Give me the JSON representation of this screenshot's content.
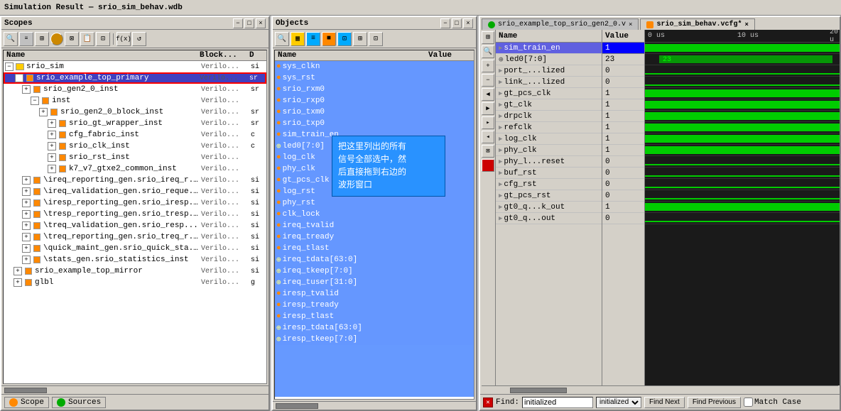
{
  "app": {
    "title": "Simulation Result — srio_sim_behav.wdb"
  },
  "scopes_panel": {
    "title": "Scopes",
    "columns": [
      "Name",
      "Block...",
      "D"
    ],
    "tree_items": [
      {
        "id": 1,
        "indent": 0,
        "expanded": true,
        "text": "srio_sim",
        "block": "Verilo...",
        "d": "si",
        "type": "module",
        "selected": false
      },
      {
        "id": 2,
        "indent": 1,
        "expanded": false,
        "text": "srio_example_top_primary",
        "block": "Verilo...",
        "d": "sr",
        "type": "inst",
        "selected": true,
        "red_border": true
      },
      {
        "id": 3,
        "indent": 2,
        "expanded": false,
        "text": "srio_gen2_0_inst",
        "block": "Verilo...",
        "d": "sr",
        "type": "inst",
        "selected": false
      },
      {
        "id": 4,
        "indent": 3,
        "expanded": true,
        "text": "inst",
        "block": "Verilo...",
        "d": "",
        "type": "inst",
        "selected": false
      },
      {
        "id": 5,
        "indent": 4,
        "expanded": false,
        "text": "srio_gen2_0_block_inst",
        "block": "Verilo...",
        "d": "sr",
        "type": "inst",
        "selected": false
      },
      {
        "id": 6,
        "indent": 5,
        "expanded": false,
        "text": "srio_gt_wrapper_inst",
        "block": "Verilo...",
        "d": "sr",
        "type": "inst",
        "selected": false
      },
      {
        "id": 7,
        "indent": 5,
        "expanded": false,
        "text": "cfg_fabric_inst",
        "block": "Verilo...",
        "d": "c",
        "type": "inst",
        "selected": false
      },
      {
        "id": 8,
        "indent": 5,
        "expanded": false,
        "text": "srio_clk_inst",
        "block": "Verilo...",
        "d": "c",
        "type": "inst",
        "selected": false
      },
      {
        "id": 9,
        "indent": 5,
        "expanded": false,
        "text": "srio_rst_inst",
        "block": "Verilo...",
        "d": "",
        "type": "inst",
        "selected": false
      },
      {
        "id": 10,
        "indent": 5,
        "expanded": false,
        "text": "k7_v7_gtxe2_common_inst",
        "block": "Verilo...",
        "d": "",
        "type": "inst",
        "selected": false
      },
      {
        "id": 11,
        "indent": 2,
        "expanded": false,
        "text": "\\ireq_reporting_gen.srio_ireq_r...",
        "block": "Verilo...",
        "d": "si",
        "type": "inst",
        "selected": false
      },
      {
        "id": 12,
        "indent": 2,
        "expanded": false,
        "text": "\\ireq_validation_gen.srio_reque...",
        "block": "Verilo...",
        "d": "si",
        "type": "inst",
        "selected": false
      },
      {
        "id": 13,
        "indent": 2,
        "expanded": false,
        "text": "\\iresp_reporting_gen.srio_iresp...",
        "block": "Verilo...",
        "d": "si",
        "type": "inst",
        "selected": false
      },
      {
        "id": 14,
        "indent": 2,
        "expanded": false,
        "text": "\\tresp_reporting_gen.srio_tresp...",
        "block": "Verilo...",
        "d": "si",
        "type": "inst",
        "selected": false
      },
      {
        "id": 15,
        "indent": 2,
        "expanded": false,
        "text": "\\treq_validation_gen.srio_resp...",
        "block": "Verilo...",
        "d": "si",
        "type": "inst",
        "selected": false
      },
      {
        "id": 16,
        "indent": 2,
        "expanded": false,
        "text": "\\treq_reporting_gen.srio_treq_r...",
        "block": "Verilo...",
        "d": "si",
        "type": "inst",
        "selected": false
      },
      {
        "id": 17,
        "indent": 2,
        "expanded": false,
        "text": "\\quick_maint_gen.srio_quick_sta...",
        "block": "Verilo...",
        "d": "si",
        "type": "inst",
        "selected": false
      },
      {
        "id": 18,
        "indent": 2,
        "expanded": false,
        "text": "\\stats_gen.srio_statistics_inst",
        "block": "Verilo...",
        "d": "si",
        "type": "inst",
        "selected": false
      },
      {
        "id": 19,
        "indent": 1,
        "expanded": false,
        "text": "srio_example_top_mirror",
        "block": "Verilo...",
        "d": "si",
        "type": "inst",
        "selected": false
      },
      {
        "id": 20,
        "indent": 1,
        "expanded": false,
        "text": "glbl",
        "block": "Verilo...",
        "d": "g",
        "type": "inst",
        "selected": false
      }
    ]
  },
  "objects_panel": {
    "title": "Objects",
    "signals": [
      "sys_clkn",
      "sys_rst",
      "srio_rxm0",
      "srio_rxp0",
      "srio_txm0",
      "srio_txp0",
      "sim_train_en",
      "led0[7:0]",
      "log_clk",
      "phy_clk",
      "gt_pcs_clk",
      "log_rst",
      "phy_rst",
      "clk_lock",
      "ireq_tvalid",
      "ireq_tready",
      "ireq_tlast",
      "ireq_tdata[63:0]",
      "ireq_tkeep[7:0]",
      "ireq_tuser[31:0]",
      "iresp_tvalid",
      "iresp_tready",
      "iresp_tlast",
      "iresp_tdata[63:0]",
      "iresp_tkeep[7:0]"
    ],
    "annotation": "把这里列出的所有\n信号全部选中，然\n后直接拖到右边的\n波形窗口"
  },
  "waveform_panel": {
    "tabs": [
      {
        "id": 1,
        "label": "srio_example_top_srio_gen2_0.v",
        "active": false,
        "icon": "green"
      },
      {
        "id": 2,
        "label": "srio_sim_behav.vcfg*",
        "active": true,
        "icon": "orange"
      }
    ],
    "signals": [
      {
        "name": "sim_train_en",
        "value": "1",
        "highlight": true
      },
      {
        "name": "led0[7:0]",
        "value": "23",
        "highlight": false,
        "expanded": true
      },
      {
        "name": "port_...lized",
        "value": "0",
        "highlight": false
      },
      {
        "name": "link_...lized",
        "value": "0",
        "highlight": false
      },
      {
        "name": "gt_pcs_clk",
        "value": "1",
        "highlight": false
      },
      {
        "name": "gt_clk",
        "value": "1",
        "highlight": false
      },
      {
        "name": "drpclk",
        "value": "1",
        "highlight": false
      },
      {
        "name": "refclk",
        "value": "1",
        "highlight": false
      },
      {
        "name": "log_clk",
        "value": "1",
        "highlight": false
      },
      {
        "name": "phy_clk",
        "value": "1",
        "highlight": false
      },
      {
        "name": "phy_l...reset",
        "value": "0",
        "highlight": false
      },
      {
        "name": "buf_rst",
        "value": "0",
        "highlight": false
      },
      {
        "name": "cfg_rst",
        "value": "0",
        "highlight": false
      },
      {
        "name": "gt_pcs_rst",
        "value": "0",
        "highlight": false
      },
      {
        "name": "gt0_q...k_out",
        "value": "1",
        "highlight": false
      },
      {
        "name": "gt0_q...out",
        "value": "0",
        "highlight": false
      }
    ],
    "time_markers": [
      "0 us",
      "10 us",
      "20 u"
    ],
    "find": {
      "label": "Find:",
      "value": "initialized",
      "find_next": "Find Next",
      "find_prev": "Find Previous",
      "match_case": "Match Case"
    }
  },
  "bottom_tabs": {
    "scope_label": "Scope",
    "sources_label": "Sources"
  },
  "icons": {
    "search": "🔍",
    "minus": "−",
    "maximize": "□",
    "close": "×",
    "restore": "⧉"
  }
}
